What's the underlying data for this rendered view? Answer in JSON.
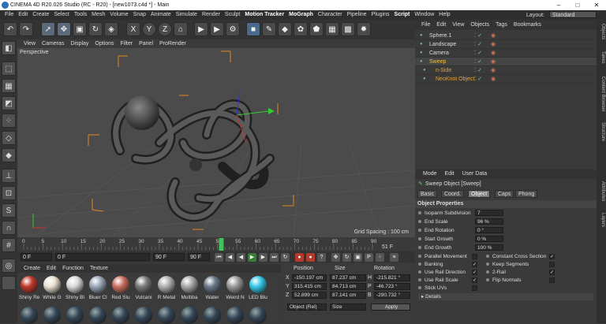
{
  "window": {
    "title": "CINEMA 4D R20.026 Studio (RC - R20) - [new1073.c4d *] - Main"
  },
  "menubar": {
    "items": [
      "File",
      "Edit",
      "Create",
      "Select",
      "Tools",
      "Mesh",
      "Volume",
      "Snap",
      "Animate",
      "Simulate",
      "Render",
      "Sculpt",
      "Motion Tracker",
      "MoGraph",
      "Character",
      "Pipeline",
      "Plugins",
      "Script",
      "Window",
      "Help"
    ],
    "layout_label": "Layout:",
    "layout_value": "Standard"
  },
  "viewport": {
    "menu": [
      "View",
      "Cameras",
      "Display",
      "Options",
      "Filter",
      "Panel",
      "ProRender"
    ],
    "label": "Perspective",
    "grid_spacing": "Grid Spacing : 100 cm"
  },
  "timeline": {
    "ticks": [
      "0",
      "5",
      "10",
      "15",
      "20",
      "25",
      "30",
      "35",
      "40",
      "45",
      "50",
      "55",
      "60",
      "65",
      "70",
      "75",
      "80",
      "85",
      "90"
    ],
    "current_frame": "51",
    "current_frame_label": "51 F",
    "start": "0 F",
    "start2": "0 F",
    "end": "90 F",
    "end2": "90 F"
  },
  "materials": {
    "menu": [
      "Create",
      "Edit",
      "Function",
      "Texture"
    ],
    "items": [
      {
        "label": "Shiny Re",
        "color": "#c0392b"
      },
      {
        "label": "White G",
        "color": "#e8e0d0"
      },
      {
        "label": "Shiny Bl",
        "color": "#d8d8d8"
      },
      {
        "label": "Bluer Cl",
        "color": "#9aa6b8"
      },
      {
        "label": "Red Slu",
        "color": "#c9705f"
      },
      {
        "label": "Vulcani",
        "color": "#7a7a7a"
      },
      {
        "label": "R Metal",
        "color": "#b0b0b0"
      },
      {
        "label": "Multiba",
        "color": "#aaaaaa"
      },
      {
        "label": "Water",
        "color": "#6a7a8a"
      },
      {
        "label": "Weird N",
        "color": "#9a9a9a"
      },
      {
        "label": "LED Blu",
        "color": "#35c8e8"
      }
    ]
  },
  "coords": {
    "headers": [
      "Position",
      "Size",
      "Rotation"
    ],
    "rows": [
      {
        "axis": "X",
        "pos": "-150.197 cm",
        "size": "87.237 cm",
        "rot_axis": "H",
        "rot": "-215.821 °"
      },
      {
        "axis": "Y",
        "pos": "315.415 cm",
        "size": "84.713 cm",
        "rot_axis": "P",
        "rot": "-46.723 °"
      },
      {
        "axis": "Z",
        "pos": "52.899 cm",
        "size": "87.141 cm",
        "rot_axis": "B",
        "rot": "-290.732 °"
      }
    ],
    "mode": "Object (Rel)",
    "size_mode": "Size",
    "apply": "Apply"
  },
  "objects": {
    "menu": [
      "File",
      "Edit",
      "View",
      "Objects",
      "Tags",
      "Bookmarks"
    ],
    "items": [
      {
        "name": "Sphere.1",
        "color": "#ddd"
      },
      {
        "name": "Landscape",
        "color": "#ddd"
      },
      {
        "name": "Camera",
        "color": "#ddd"
      },
      {
        "name": "Sweep",
        "color": "#f0c040"
      },
      {
        "name": "n-Side",
        "color": "#e8a030"
      },
      {
        "name": "NeoKnot Object",
        "color": "#e8a030"
      }
    ]
  },
  "attributes": {
    "menu": [
      "Mode",
      "Edit",
      "User Data"
    ],
    "title": "Sweep Object [Sweep]",
    "tabs": [
      "Basic",
      "Coord.",
      "Object",
      "Caps",
      "Phong"
    ],
    "selected_tab": "Object",
    "section": "Object Properties",
    "fields": [
      {
        "label": "Isoparm Subdivision",
        "value": "7"
      },
      {
        "label": "End Scale",
        "value": "96 %"
      },
      {
        "label": "End Rotation",
        "value": "0 °"
      },
      {
        "label": "Start Growth",
        "value": "0 %"
      },
      {
        "label": "End Growth",
        "value": "100 %"
      }
    ],
    "checks_left": [
      {
        "label": "Parallel Movement",
        "checked": false
      },
      {
        "label": "Banking",
        "checked": true
      },
      {
        "label": "Use Rail Direction",
        "checked": true
      },
      {
        "label": "Use Rail Scale",
        "checked": true
      },
      {
        "label": "Stick UVs",
        "checked": false
      }
    ],
    "checks_right": [
      {
        "label": "Constant Cross Section",
        "checked": true
      },
      {
        "label": "Keep Segments",
        "checked": false
      },
      {
        "label": "2-Rail",
        "checked": true
      },
      {
        "label": "Flip Normals",
        "checked": false
      }
    ],
    "details": "Details"
  },
  "side_tabs": [
    "Objects",
    "Takes",
    "Content Browser",
    "Structure",
    "Attributes",
    "Layers"
  ]
}
